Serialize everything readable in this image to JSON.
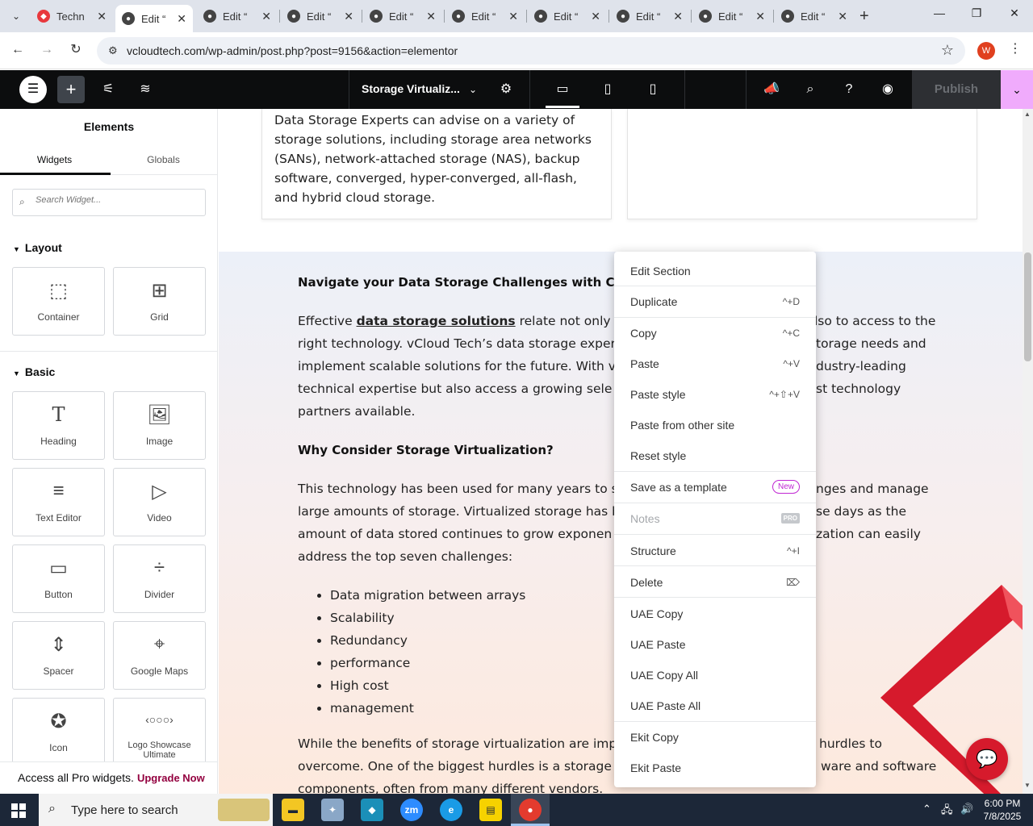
{
  "browser": {
    "tabs": [
      {
        "label": "Techn",
        "favicon_color": "#e8383d"
      },
      {
        "label": "Edit “",
        "favicon_color": "#444"
      },
      {
        "label": "Edit “",
        "favicon_color": "#444"
      },
      {
        "label": "Edit “",
        "favicon_color": "#444"
      },
      {
        "label": "Edit “",
        "favicon_color": "#444"
      },
      {
        "label": "Edit “",
        "favicon_color": "#444"
      },
      {
        "label": "Edit “",
        "favicon_color": "#444"
      },
      {
        "label": "Edit “",
        "favicon_color": "#444"
      },
      {
        "label": "Edit “",
        "favicon_color": "#444"
      },
      {
        "label": "Edit “",
        "favicon_color": "#444"
      }
    ],
    "url": "vcloudtech.com/wp-admin/post.php?post=9156&action=elementor",
    "profile_initial": "W"
  },
  "editor": {
    "document_title": "Storage Virtualiz...",
    "publish_label": "Publish"
  },
  "panel": {
    "title": "Elements",
    "tabs": [
      "Widgets",
      "Globals"
    ],
    "search_placeholder": "Search Widget...",
    "sections": {
      "layout": "Layout",
      "basic": "Basic"
    },
    "widgets": {
      "container": "Container",
      "grid": "Grid",
      "heading": "Heading",
      "image": "Image",
      "text_editor": "Text Editor",
      "video": "Video",
      "button": "Button",
      "divider": "Divider",
      "spacer": "Spacer",
      "google_maps": "Google Maps",
      "icon": "Icon",
      "logo_showcase": "Logo Showcase Ultimate"
    },
    "upgrade_text": "Access all Pro widgets.",
    "upgrade_link": "Upgrade Now"
  },
  "canvas": {
    "card_text": "Data Storage Experts can advise on a variety of storage solutions, including storage area networks (SANs), network-attached storage (NAS), backup software, converged, hyper-converged, all-flash, and hybrid cloud storage.",
    "heading1": "Navigate your Data Storage Challenges with Confi",
    "para1": {
      "line1_pre": "Effective ",
      "line1_link": "data storage solutions",
      "line1_post": " relate not only to t",
      "line1_right": "lso to access to the",
      "line2": "right technology. vCloud Tech’s data storage exper",
      "line2_right": "torage needs and",
      "line3": "implement scalable solutions for the future. With v",
      "line3_right": "dustry-leading",
      "line4": "technical expertise but also access a growing sele",
      "line4_right": "st technology",
      "line5": "partners available."
    },
    "heading2": "Why Consider Storage Virtualization?",
    "para2": {
      "line1": "This technology has been used for many years to s",
      "line1_right": "nges and manage",
      "line2": "large amounts of storage. Virtualized storage has b",
      "line2_right": "se days as the",
      "line3": "amount of data stored continues to grow exponen",
      "line3_right": "zation can easily",
      "line4": "address the  top seven challenges:"
    },
    "bullets": [
      "Data migration between arrays",
      "Scalability",
      "Redundancy",
      "performance",
      "High cost",
      "management"
    ],
    "para3": {
      "line1": "While the benefits of storage virtualization are imp",
      "line1_right": "hurdles to",
      "line2": "overcome. One of the biggest hurdles is a storage e",
      "line2_right": "ware and software",
      "line3": "components, often from many different vendors."
    }
  },
  "context_menu": {
    "items": [
      {
        "label": "Edit Section",
        "shortcut": ""
      },
      {
        "label": "Duplicate",
        "shortcut": "^+D"
      },
      {
        "label": "Copy",
        "shortcut": "^+C"
      },
      {
        "label": "Paste",
        "shortcut": "^+V"
      },
      {
        "label": "Paste style",
        "shortcut": "^+⇧+V"
      },
      {
        "label": "Paste from other site",
        "shortcut": ""
      },
      {
        "label": "Reset style",
        "shortcut": ""
      },
      {
        "label": "Save as a template",
        "badge": "New"
      },
      {
        "label": "Notes",
        "badge": "PRO"
      },
      {
        "label": "Structure",
        "shortcut": "^+I"
      },
      {
        "label": "Delete",
        "shortcut": "⌦"
      },
      {
        "label": "UAE Copy",
        "shortcut": ""
      },
      {
        "label": "UAE Paste",
        "shortcut": ""
      },
      {
        "label": "UAE Copy All",
        "shortcut": ""
      },
      {
        "label": "UAE Paste All",
        "shortcut": ""
      },
      {
        "label": "Ekit Copy",
        "shortcut": ""
      },
      {
        "label": "Ekit Paste",
        "shortcut": ""
      }
    ]
  },
  "taskbar": {
    "search_placeholder": "Type here to search",
    "time": "6:00 PM",
    "date": "7/8/2025"
  },
  "colors": {
    "elementor_dark": "#0c0d0e",
    "accent_pink": "#f0abfc",
    "upgrade_link": "#93003f",
    "brand_red": "#d61a2c"
  }
}
